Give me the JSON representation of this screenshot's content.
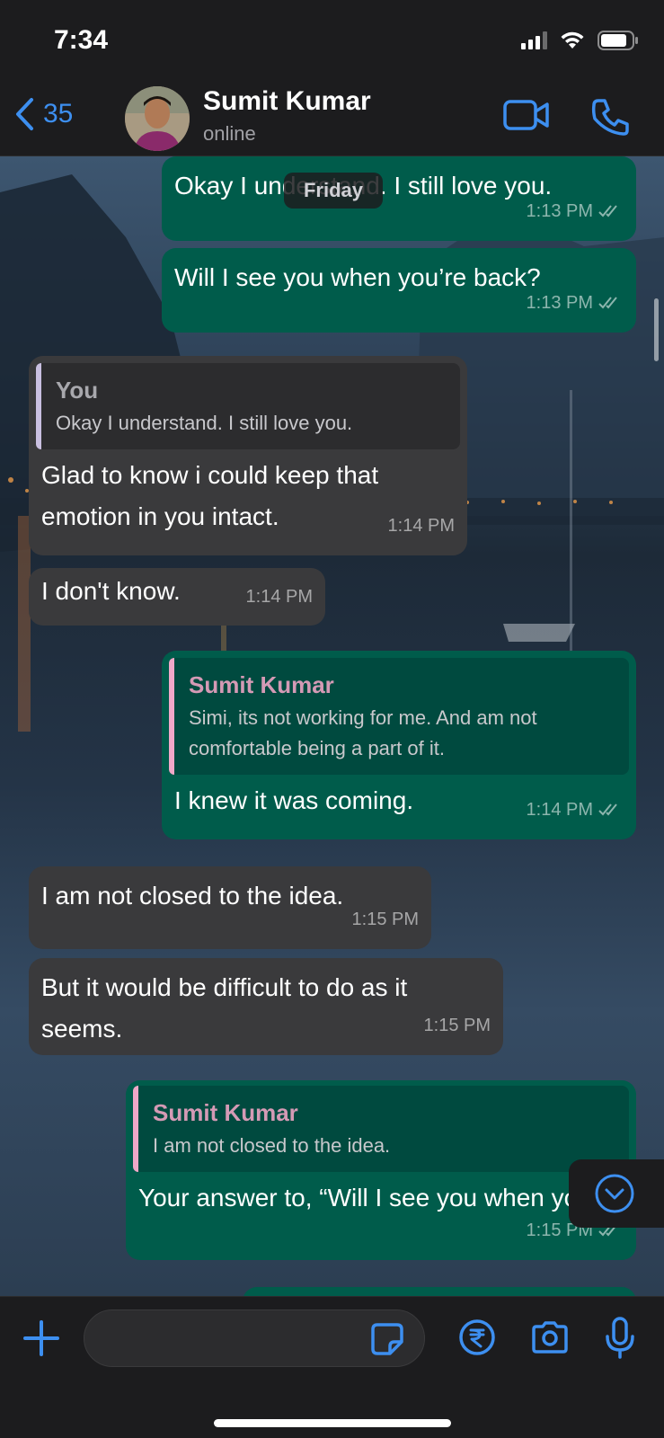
{
  "status_bar": {
    "time": "7:34"
  },
  "header": {
    "back_count": "35",
    "contact_name": "Sumit Kumar",
    "contact_status": "online"
  },
  "date_pill": "Friday",
  "messages": [
    {
      "dir": "out",
      "text": "Okay I understand. I still love you.",
      "time": "1:13 PM"
    },
    {
      "dir": "out",
      "text": "Will I see you when you’re back?",
      "time": "1:13 PM"
    },
    {
      "dir": "in",
      "quote_author": "You",
      "quote_text": "Okay I understand. I still love you.",
      "text": "Glad to know i could keep that emotion in you intact.",
      "time": "1:14 PM"
    },
    {
      "dir": "in",
      "text": "I don't know.",
      "time": "1:14 PM"
    },
    {
      "dir": "out",
      "quote_author": "Sumit Kumar",
      "quote_text": "Simi, its not working for me. And am not comfortable being a part of it.",
      "text": "I knew it was coming.",
      "time": "1:14 PM"
    },
    {
      "dir": "in",
      "text": "I am not closed to the idea.",
      "time": "1:15 PM"
    },
    {
      "dir": "in",
      "text": "But it would be difficult to do as it seems.",
      "time": "1:15 PM"
    },
    {
      "dir": "out",
      "quote_author": "Sumit Kumar",
      "quote_text": "I am not closed to the idea.",
      "text": "Your answer to, “Will I see you when you’re back?”",
      "time": "1:15 PM"
    }
  ],
  "input": {
    "placeholder": ""
  },
  "colors": {
    "accent": "#3d8ff0",
    "outgoing": "#005c4b",
    "incoming": "#3a3a3c"
  }
}
